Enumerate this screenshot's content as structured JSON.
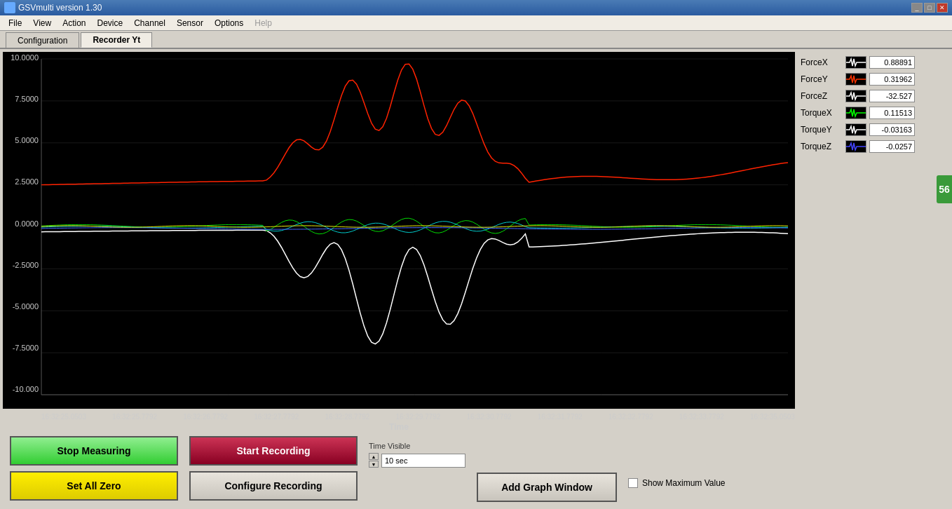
{
  "titlebar": {
    "title": "GSVmulti version 1.30",
    "min_label": "_",
    "max_label": "□",
    "close_label": "✕"
  },
  "menubar": {
    "items": [
      {
        "label": "File",
        "disabled": false
      },
      {
        "label": "View",
        "disabled": false
      },
      {
        "label": "Action",
        "disabled": false
      },
      {
        "label": "Device",
        "disabled": false
      },
      {
        "label": "Channel",
        "disabled": false
      },
      {
        "label": "Sensor",
        "disabled": false
      },
      {
        "label": "Options",
        "disabled": false
      },
      {
        "label": "Help",
        "disabled": true
      }
    ]
  },
  "tabs": [
    {
      "label": "Configuration",
      "active": false
    },
    {
      "label": "Recorder Yt",
      "active": true
    }
  ],
  "chart": {
    "y_labels": [
      "10.0000",
      "7.5000",
      "5.0000",
      "2.5000",
      "0.0000",
      "-2.5000",
      "-5.0000",
      "-7.5000",
      "-10.000"
    ],
    "x_labels": [
      "16:32:25.0503",
      "16:32:25.7792",
      "16:32:26.7792",
      "16:32:27.7792",
      "16:32:28.7792",
      "16:32:29.7792",
      "16:32:30.7792",
      "16:32:31.7792",
      "16:32:32.7792",
      "16:32:33.7792",
      "16:32:35.0503"
    ],
    "x_axis_title": "Time"
  },
  "legend": {
    "items": [
      {
        "label": "ForceX",
        "color": "#ffffff",
        "value": "0.88891"
      },
      {
        "label": "ForceY",
        "color": "#ff3300",
        "value": "0.31962"
      },
      {
        "label": "ForceZ",
        "color": "#ffffff",
        "value": "-32.527"
      },
      {
        "label": "TorqueX",
        "color": "#00ff00",
        "value": "0.11513"
      },
      {
        "label": "TorqueY",
        "color": "#ffffff",
        "value": "-0.03163"
      },
      {
        "label": "TorqueZ",
        "color": "#4444ff",
        "value": "-0.0257"
      }
    ]
  },
  "buttons": {
    "stop_measuring": "Stop Measuring",
    "start_recording": "Start Recording",
    "set_all_zero": "Set All Zero",
    "configure_recording": "Configure Recording",
    "add_graph_window": "Add Graph Window"
  },
  "time_visible": {
    "label": "Time Visible",
    "value": "10 sec"
  },
  "show_max": {
    "label": "Show Maximum Value"
  },
  "side_tab": {
    "label": "56"
  }
}
